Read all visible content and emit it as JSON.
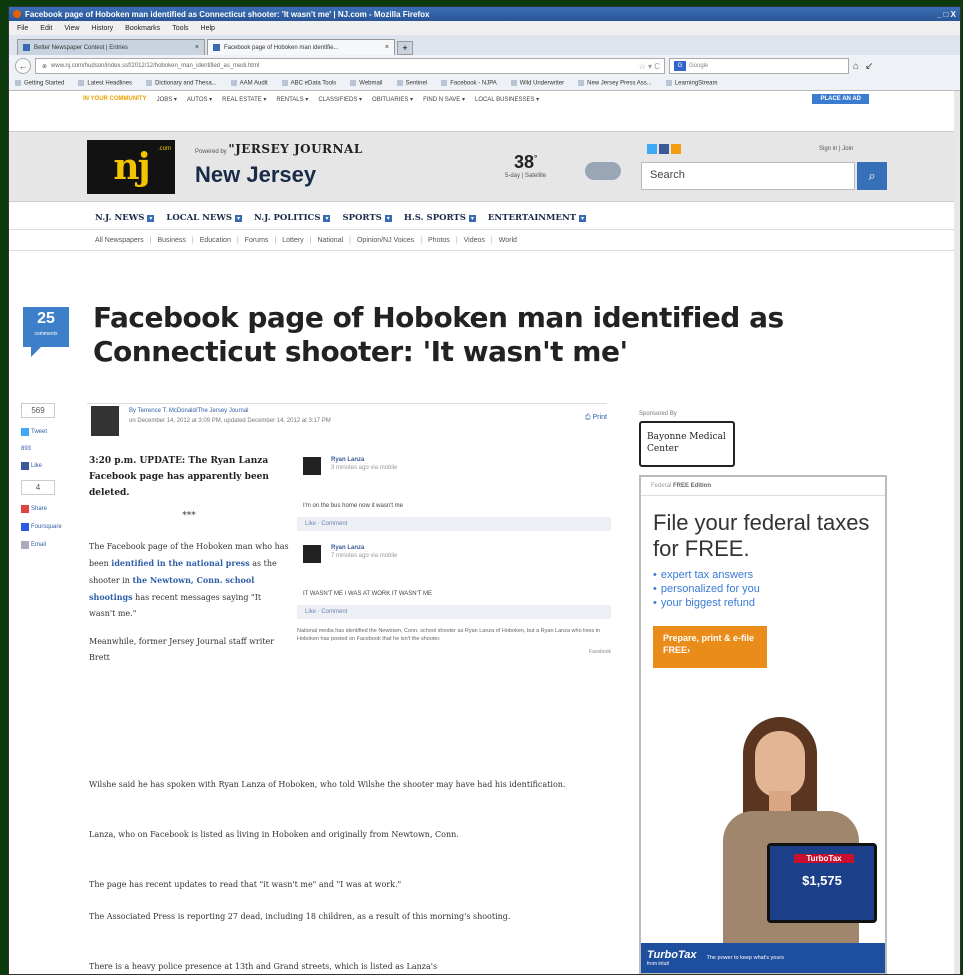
{
  "window": {
    "title": "Facebook page of Hoboken man identified as Connecticut shooter: 'It wasn't me' | NJ.com - Mozilla Firefox",
    "controls": "_ □ X"
  },
  "menu": [
    "File",
    "Edit",
    "View",
    "History",
    "Bookmarks",
    "Tools",
    "Help"
  ],
  "tabs": [
    {
      "label": "Better Newspaper Contest | Entries",
      "active": false
    },
    {
      "label": "Facebook page of Hoboken man identifie...",
      "active": true
    }
  ],
  "newtab": "+",
  "nav": {
    "back": "←",
    "url": "www.nj.com/hudson/index.ssf/2012/12/hoboken_man_identified_as_medi.html",
    "star": "☆ ▾ C",
    "search_placeholder": "Google",
    "icons": [
      "⌂",
      "↙"
    ]
  },
  "bookmarks": [
    "Getting Started",
    "Latest Headlines",
    "Dictionary and Thesa...",
    "AAM Audit",
    "ABC eData Tools",
    "Webmail",
    "Sentinel",
    "Facebook - NJPA",
    "Wild Underwriter",
    "New Jersey Press Ass...",
    "LearningStream"
  ],
  "topstrip": {
    "label": "IN YOUR COMMUNITY",
    "items": [
      "JOBS ▾",
      "AUTOS ▾",
      "REAL ESTATE ▾",
      "RENTALS ▾",
      "CLASSIFIEDS ▾",
      "OBITUARIES ▾",
      "FIND N SAVE ▾",
      "LOCAL BUSINESSES ▾"
    ],
    "place_ad": "PLACE AN AD"
  },
  "masthead": {
    "logo_text": "nj",
    "logo_suffix": ".com",
    "powered_label": "Powered by",
    "powered_name": "\"JERSEY JOURNAL",
    "region": "New Jersey",
    "temp": "38",
    "temp_unit": "°",
    "forecast": "5-day | Satellite",
    "signin": "Sign in | Join",
    "search_label": "Search",
    "search_icon": "⌕"
  },
  "mainnav": [
    "N.J. NEWS",
    "LOCAL NEWS",
    "N.J. POLITICS",
    "SPORTS",
    "H.S. SPORTS",
    "ENTERTAINMENT"
  ],
  "subnav": [
    "All Newspapers",
    "Business",
    "Education",
    "Forums",
    "Lottery",
    "National",
    "Opinion/NJ Voices",
    "Photos",
    "Videos",
    "World"
  ],
  "comments": {
    "count": "25",
    "label": "comments"
  },
  "headline": "Facebook page of Hoboken man identified as Connecticut shooter: 'It wasn't me'",
  "share": {
    "count": "569",
    "tweet": "Tweet",
    "plusone": "893",
    "like": "Like",
    "like_count": "4",
    "share_label": "Share",
    "foursquare": "Foursquare",
    "email": "Email"
  },
  "byline": {
    "prefix": "By",
    "author": "Terrence T. McDonald/The Jersey Journal",
    "date": "on December 14, 2012 at 3:09 PM, updated December 14, 2012 at 3:17 PM",
    "print": "Print"
  },
  "article": {
    "update": "3:20 p.m. UPDATE: The Ryan Lanza Facebook page has apparently been deleted.",
    "stars": "***",
    "p1_a": "The Facebook page of the Hoboken man who has been ",
    "p1_link1": "identified in the national press",
    "p1_b": " as the shooter in ",
    "p1_link2": "the Newtown, Conn. school shootings",
    "p1_c": " has recent messages saying \"It wasn't me.\"",
    "p2_start": "Meanwhile, former Jersey Journal staff writer Brett",
    "p2_rest": "Wilshe said he has spoken with Ryan Lanza of Hoboken, who told Wilshe the shooter may have had his identification.",
    "p3": "Lanza, who on Facebook is listed as living in Hoboken and originally from Newtown, Conn.",
    "p4": "The page has recent updates to read that \"it wasn't me\" and \"I was at work.\"",
    "p5": "The Associated Press is reporting 27 dead, including 18 children, as a result of this morning's shooting.",
    "p6": "There is a heavy police presence at 13th and Grand streets, which is listed as Lanza's"
  },
  "facebook": {
    "posts": [
      {
        "name": "Ryan Lanza",
        "time": "3 minutes ago via mobile",
        "message": "I'm on the bus home now it wasn't me",
        "actions": "Like · Comment"
      },
      {
        "name": "Ryan Lanza",
        "time": "7 minutes ago via mobile",
        "message": "IT WASN'T ME I WAS AT WORK IT WASN'T ME",
        "actions": "Like · Comment"
      }
    ],
    "caption": "National media has identified the Newtown, Conn. school shooter as Ryan Lanza of Hoboken, but a Ryan Lanza who lives in Hoboken has posted on Facebook that he isn't the shooter.",
    "source": "Facebook"
  },
  "sponsor": {
    "label": "Sponsored By",
    "name": "Bayonne Medical Center"
  },
  "ad": {
    "edition_prefix": "Federal",
    "edition_bold": "FREE Edition",
    "headline": "File your federal taxes for FREE.",
    "bullets": [
      "expert tax answers",
      "personalized for you",
      "your biggest refund"
    ],
    "cta": "Prepare, print & e-file FREE›",
    "tablet_brand": "TurboTax",
    "tablet_amount": "$1,575",
    "footer_brand": "TurboTax",
    "footer_sub": "from intuit",
    "footer_slogan": "The power to keep what's yours"
  },
  "colors": {
    "accent": "#3670b8",
    "logo_bg": "#121212",
    "logo_fg": "#f4c400",
    "comment_badge": "#3d7fc9",
    "cta": "#e98c1a",
    "ad_footer": "#1e4f9e"
  }
}
